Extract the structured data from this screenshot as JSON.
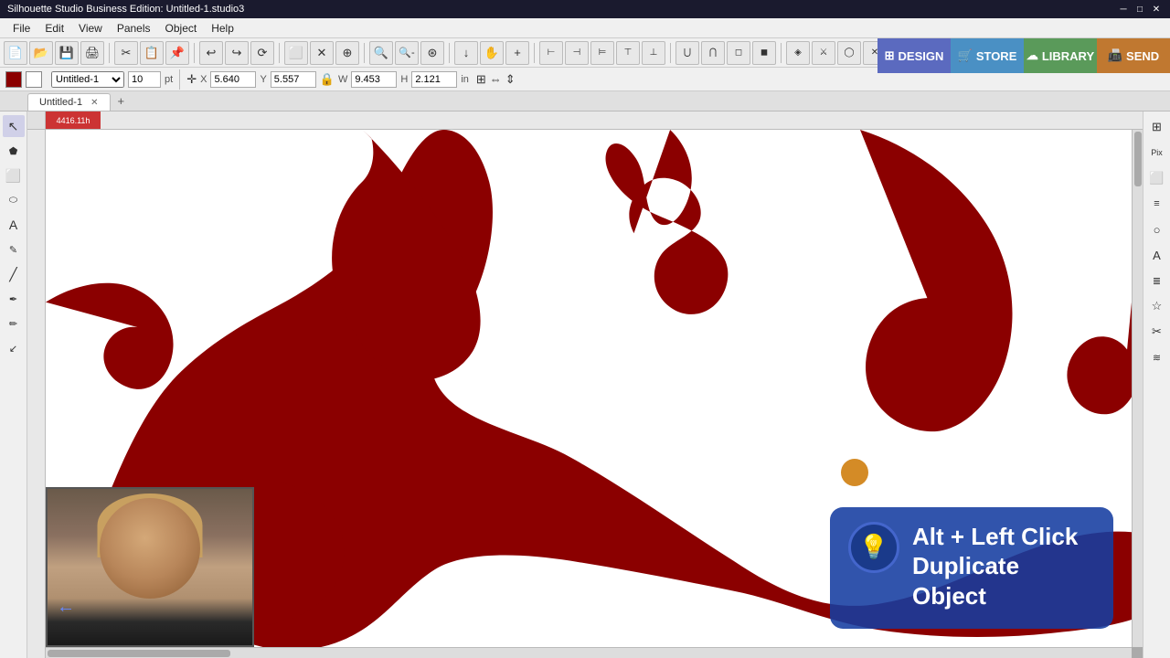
{
  "titlebar": {
    "title": "Silhouette Studio Business Edition: Untitled-1.studio3",
    "min": "─",
    "max": "□",
    "close": "✕"
  },
  "menubar": {
    "items": [
      "File",
      "Edit",
      "View",
      "Panels",
      "Object",
      "Help"
    ]
  },
  "toolbar": {
    "buttons": [
      "↩",
      "↪",
      "⟳",
      "⬜",
      "✕",
      "⊕",
      "🔍+",
      "🔍-",
      "⊛",
      "↓",
      "✋",
      "+"
    ],
    "undo_label": "↩",
    "redo_label": "↪"
  },
  "propbar": {
    "w_label": "W",
    "w_value": "9.453",
    "h_label": "H",
    "h_value": "2.121",
    "unit": "in",
    "x_label": "X",
    "x_value": "5.640",
    "y_label": "Y",
    "y_value": "5.557"
  },
  "tabbar": {
    "tabs": [
      {
        "label": "Untitled-1",
        "active": true
      }
    ],
    "add_label": "+"
  },
  "left_tools": {
    "tools": [
      "↖",
      "✏",
      "⬜",
      "✒",
      "A",
      "✎",
      "⊕",
      "✏",
      "╱",
      "↙"
    ]
  },
  "top_nav": {
    "design": {
      "label": "DESIGN",
      "icon": "⊞"
    },
    "store": {
      "label": "STORE",
      "icon": "🛍"
    },
    "library": {
      "label": "LIBRARY",
      "icon": "📚"
    },
    "send": {
      "label": "SEND",
      "icon": "📠"
    }
  },
  "canvas": {
    "selection_label": "4416.11h"
  },
  "cursor": {
    "visible": true
  },
  "tooltip": {
    "icon": "💡",
    "line1": "Alt + Left Click",
    "line2": "Duplicate Object"
  },
  "webcam": {
    "arrow": "←"
  },
  "right_panel": {
    "icons": [
      "▤",
      "Pix",
      "⬜",
      "≡",
      "○",
      "A",
      "≣",
      "☆",
      "✂",
      "≋"
    ]
  }
}
